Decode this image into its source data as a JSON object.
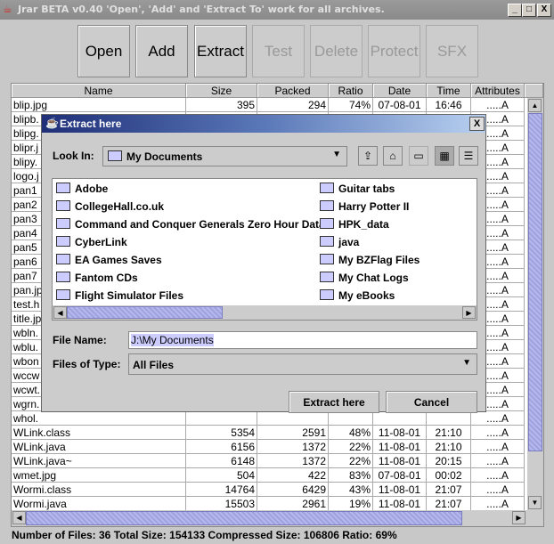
{
  "window": {
    "title": "Jrar BETA v0.40 'Open', 'Add' and 'Extract To' work for all archives.",
    "minimize": "_",
    "maximize": "□",
    "close": "X"
  },
  "toolbar": [
    {
      "label": "Open",
      "enabled": true
    },
    {
      "label": "Add",
      "enabled": true
    },
    {
      "label": "Extract",
      "enabled": true
    },
    {
      "label": "Test",
      "enabled": false
    },
    {
      "label": "Delete",
      "enabled": false
    },
    {
      "label": "Protect",
      "enabled": false
    },
    {
      "label": "SFX",
      "enabled": false
    }
  ],
  "table": {
    "columns": [
      "Name",
      "Size",
      "Packed",
      "Ratio",
      "Date",
      "Time",
      "Attributes"
    ],
    "rows": [
      [
        "blip.jpg",
        "395",
        "294",
        "74%",
        "07-08-01",
        "16:46",
        ".....A"
      ],
      [
        "blipb.",
        "",
        "",
        "",
        "",
        "",
        ".....A"
      ],
      [
        "blipg.",
        "",
        "",
        "",
        "",
        "",
        ".....A"
      ],
      [
        "blipr.j",
        "",
        "",
        "",
        "",
        "",
        ".....A"
      ],
      [
        "blipy.",
        "",
        "",
        "",
        "",
        "",
        ".....A"
      ],
      [
        "logo.j",
        "",
        "",
        "",
        "",
        "",
        ".....A"
      ],
      [
        "pan1",
        "",
        "",
        "",
        "",
        "",
        ".....A"
      ],
      [
        "pan2",
        "",
        "",
        "",
        "",
        "",
        ".....A"
      ],
      [
        "pan3",
        "",
        "",
        "",
        "",
        "",
        ".....A"
      ],
      [
        "pan4",
        "",
        "",
        "",
        "",
        "",
        ".....A"
      ],
      [
        "pan5",
        "",
        "",
        "",
        "",
        "",
        ".....A"
      ],
      [
        "pan6",
        "",
        "",
        "",
        "",
        "",
        ".....A"
      ],
      [
        "pan7",
        "",
        "",
        "",
        "",
        "",
        ".....A"
      ],
      [
        "pan.jp",
        "",
        "",
        "",
        "",
        "",
        ".....A"
      ],
      [
        "test.h",
        "",
        "",
        "",
        "",
        "",
        ".....A"
      ],
      [
        "title.jp",
        "",
        "",
        "",
        "",
        "",
        ".....A"
      ],
      [
        "wbln.",
        "",
        "",
        "",
        "",
        "",
        ".....A"
      ],
      [
        "wblu.",
        "",
        "",
        "",
        "",
        "",
        ".....A"
      ],
      [
        "wbon",
        "",
        "",
        "",
        "",
        "",
        ".....A"
      ],
      [
        "wccw",
        "",
        "",
        "",
        "",
        "",
        ".....A"
      ],
      [
        "wcwt.",
        "",
        "",
        "",
        "",
        "",
        ".....A"
      ],
      [
        "wgrn.",
        "",
        "",
        "",
        "",
        "",
        ".....A"
      ],
      [
        "whol.",
        "",
        "",
        "",
        "",
        "",
        ".....A"
      ],
      [
        "WLink.class",
        "5354",
        "2591",
        "48%",
        "11-08-01",
        "21:10",
        ".....A"
      ],
      [
        "WLink.java",
        "6156",
        "1372",
        "22%",
        "11-08-01",
        "21:10",
        ".....A"
      ],
      [
        "WLink.java~",
        "6148",
        "1372",
        "22%",
        "11-08-01",
        "20:15",
        ".....A"
      ],
      [
        "wmet.jpg",
        "504",
        "422",
        "83%",
        "07-08-01",
        "00:02",
        ".....A"
      ],
      [
        "Wormi.class",
        "14764",
        "6429",
        "43%",
        "11-08-01",
        "21:07",
        ".....A"
      ],
      [
        "Wormi.java",
        "15503",
        "2961",
        "19%",
        "11-08-01",
        "21:07",
        ".....A"
      ]
    ]
  },
  "dialog": {
    "title": "Extract here",
    "close": "X",
    "look_in_label": "Look In:",
    "look_in_value": "My Documents",
    "icons": [
      "up-folder-icon",
      "home-icon",
      "new-folder-icon",
      "list-view-icon",
      "details-view-icon"
    ],
    "files_col1": [
      "Adobe",
      "CollegeHall.co.uk",
      "Command and Conquer Generals Zero Hour Data",
      "CyberLink",
      "EA Games Saves",
      "Fantom CDs",
      "Flight Simulator Files"
    ],
    "files_col2": [
      "Guitar tabs",
      "Harry Potter II",
      "HPK_data",
      "java",
      "My BZFlag Files",
      "My Chat Logs",
      "My eBooks"
    ],
    "file_name_label": "File Name:",
    "file_name_value": "J:\\My Documents",
    "files_of_type_label": "Files of Type:",
    "files_of_type_value": "All Files",
    "extract_button": "Extract here",
    "cancel_button": "Cancel"
  },
  "status": "Number of Files: 36 Total Size: 154133 Compressed Size: 106806 Ratio: 69%",
  "colors": {
    "selection": "#ccccff",
    "scroll_thumb": "#9fa2dd",
    "title_gradient_start": "#1f2f78"
  }
}
